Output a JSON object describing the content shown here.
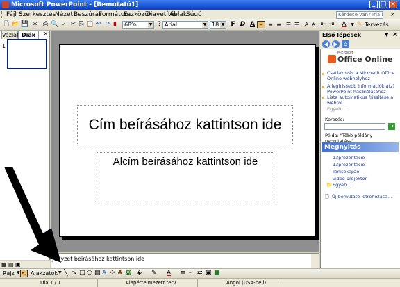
{
  "window": {
    "title": "Microsoft PowerPoint - [Bemutató1]"
  },
  "menu": [
    {
      "label": "Fájl",
      "u": "F"
    },
    {
      "label": "Szerkesztés",
      "u": "S"
    },
    {
      "label": "Nézet",
      "u": "N"
    },
    {
      "label": "Beszúrás",
      "u": "B"
    },
    {
      "label": "Formátum",
      "u": "o"
    },
    {
      "label": "Eszközök",
      "u": "E"
    },
    {
      "label": "Diavetítés",
      "u": "D"
    },
    {
      "label": "Ablak",
      "u": "A"
    },
    {
      "label": "Súgó",
      "u": "S"
    }
  ],
  "help_box": {
    "placeholder": "Kérdése van? Írja be ide."
  },
  "toolbar": {
    "zoom": "68%",
    "font": "Arial",
    "font_size": "18",
    "bold": "F",
    "italic": "D",
    "underline": "A",
    "shadow": "S",
    "design_label": "Tervezés"
  },
  "left_panel": {
    "tab_outline": "Vázlat",
    "tab_slides": "Diák",
    "slide_number": "1"
  },
  "slide": {
    "title_placeholder": "Cím beírásához kattintson ide",
    "subtitle_placeholder": "Alcím beírásához kattintson ide"
  },
  "notes": {
    "placeholder": "Jegyzet beírásához kattintson ide"
  },
  "task_pane": {
    "title": "Első lépések",
    "logo_small": "Microsoft",
    "logo_text": "Office Online",
    "links": [
      "Csatlakozás a Microsoft Office Online webhelyhez",
      "A legfrissebb információk a(z) PowerPoint használatához",
      "Lista automatikus frissítése a webről"
    ],
    "more": "Egyéb...",
    "search_label": "Keresés:",
    "example": "Példa: \"Több példány nyomtatása\"",
    "open_header": "Megnyitás",
    "files": [
      "13prezentacio",
      "13prezentacio",
      "Tanitokepzo",
      "video projektor"
    ],
    "files_more": "Egyéb...",
    "new_presentation": "Új bemutató létrehozása..."
  },
  "draw_toolbar": {
    "draw": "Rajz",
    "autoshapes": "Alakzatok"
  },
  "status": {
    "slide": "Dia 1 / 1",
    "template": "Alapértelmezett terv",
    "language": "Angol (USA-beli)"
  },
  "colors": {
    "title_bar": "#0a3fbf",
    "task_header": "#3e6fd0",
    "link": "#1e3f95"
  }
}
